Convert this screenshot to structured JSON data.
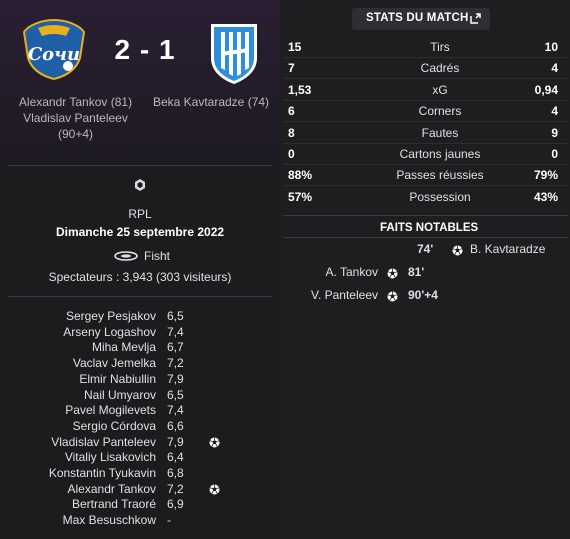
{
  "match": {
    "score": "2 - 1",
    "home_scorers": [
      "Alexandr Tankov (81)",
      "Vladislav Panteleev",
      "(90+4)"
    ],
    "away_scorers": [
      "Beka Kavtaradze (74)"
    ],
    "competition": "RPL",
    "date": "Dimanche 25 septembre 2022",
    "stadium": "Fisht",
    "attendance": "Spectateurs : 3,943 (303 visiteurs)"
  },
  "players": [
    {
      "name": "Sergey Pesjakov",
      "rating": "6,5",
      "goal": false
    },
    {
      "name": "Arseny Logashov",
      "rating": "7,4",
      "goal": false
    },
    {
      "name": "Miha Mevlja",
      "rating": "6,7",
      "goal": false
    },
    {
      "name": "Vaclav Jemelka",
      "rating": "7,2",
      "goal": false
    },
    {
      "name": "Elmir Nabiullin",
      "rating": "7,9",
      "goal": false
    },
    {
      "name": "Nail Umyarov",
      "rating": "6,5",
      "goal": false
    },
    {
      "name": "Pavel Mogilevets",
      "rating": "7,4",
      "goal": false
    },
    {
      "name": "Sergio Córdova",
      "rating": "6,6",
      "goal": false
    },
    {
      "name": "Vladislav Panteleev",
      "rating": "7,9",
      "goal": true
    },
    {
      "name": "Vitaliy Lisakovich",
      "rating": "6,4",
      "goal": false
    },
    {
      "name": "Konstantin Tyukavin",
      "rating": "6,8",
      "goal": false
    },
    {
      "name": "Alexandr Tankov",
      "rating": "7,2",
      "goal": true
    },
    {
      "name": "Bertrand Traoré",
      "rating": "6,9",
      "goal": false
    },
    {
      "name": "Max Besuschkow",
      "rating": "-",
      "goal": false
    }
  ],
  "stats_header": "STATS DU MATCH",
  "stats": [
    {
      "home": "15",
      "label": "Tirs",
      "away": "10"
    },
    {
      "home": "7",
      "label": "Cadrés",
      "away": "4"
    },
    {
      "home": "1,53",
      "label": "xG",
      "away": "0,94"
    },
    {
      "home": "6",
      "label": "Corners",
      "away": "4"
    },
    {
      "home": "8",
      "label": "Fautes",
      "away": "9"
    },
    {
      "home": "0",
      "label": "Cartons jaunes",
      "away": "0"
    },
    {
      "home": "88%",
      "label": "Passes réussies",
      "away": "79%"
    },
    {
      "home": "57%",
      "label": "Possession",
      "away": "43%"
    }
  ],
  "events_header": "FAITS NOTABLES",
  "events": [
    {
      "minute": "74'",
      "player": "B. Kavtaradze",
      "side": "away"
    },
    {
      "minute": "81'",
      "player": "A. Tankov",
      "side": "home"
    },
    {
      "minute": "90'+4",
      "player": "V. Panteleev",
      "side": "home"
    }
  ],
  "colors": {
    "hero_top": "#2a1f33",
    "sochi_blue": "#1f5fa8",
    "sochi_gold": "#e8b020",
    "nizhny_blue": "#2f8fdc",
    "panel": "#1e1e21"
  },
  "icons": [
    "sochi-crest",
    "nizhny-crest",
    "football-icon",
    "expand-icon",
    "rpl-logo",
    "stadium-icon"
  ]
}
